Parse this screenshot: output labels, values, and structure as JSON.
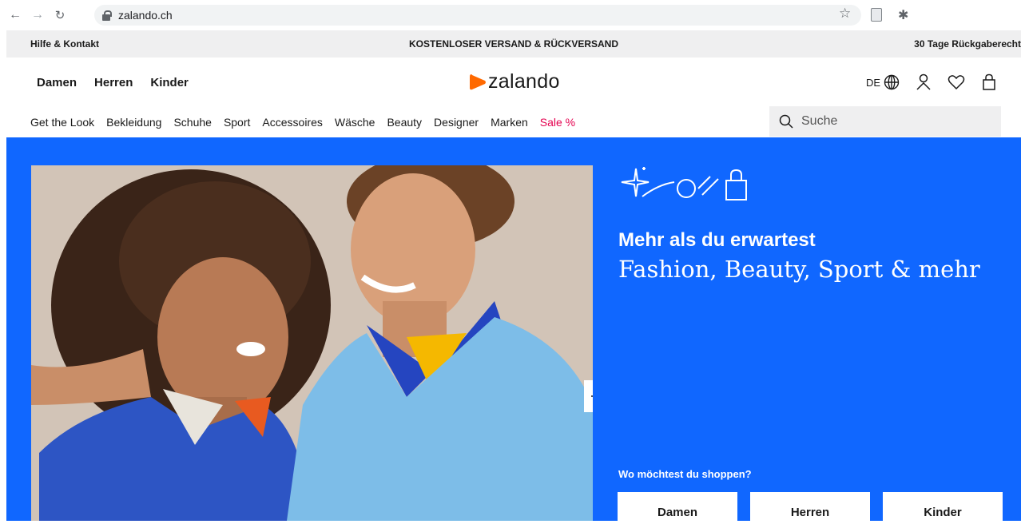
{
  "browser": {
    "url": "zalando.ch",
    "icons": [
      "back-icon",
      "forward-icon",
      "reload-icon",
      "lock-icon",
      "star-icon",
      "document-icon",
      "puzzle-icon"
    ]
  },
  "info_bar": {
    "left": "Hilfe & Kontakt",
    "center": "KOSTENLOSER VERSAND & RÜCKVERSAND",
    "right": "30 Tage Rückgaberecht"
  },
  "header": {
    "gender_nav": [
      "Damen",
      "Herren",
      "Kinder"
    ],
    "logo_text": "zalando",
    "language": "DE"
  },
  "categories": [
    "Get the Look",
    "Bekleidung",
    "Schuhe",
    "Sport",
    "Accessoires",
    "Wäsche",
    "Beauty",
    "Designer",
    "Marken",
    "Sale %"
  ],
  "search": {
    "placeholder": "Suche"
  },
  "hero": {
    "title": "Mehr als du erwartest",
    "subtitle": "Fashion, Beauty, Sport & mehr",
    "shop_prompt": "Wo möchtest du shoppen?",
    "shop_buttons": [
      "Damen",
      "Herren",
      "Kinder"
    ]
  },
  "colors": {
    "brand_orange": "#ff6900",
    "hero_blue": "#1067ff",
    "sale_pink": "#e4004f"
  }
}
